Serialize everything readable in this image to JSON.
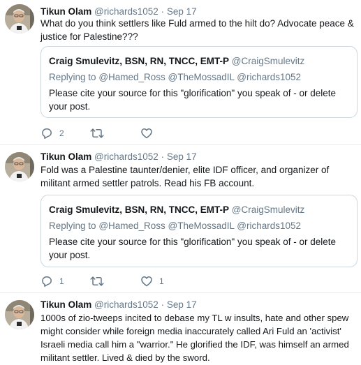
{
  "tweets": [
    {
      "name": "Tikun Olam",
      "handle": "@richards1052",
      "dot": "·",
      "date": "Sep 17",
      "text": "What do you think settlers like Fuld armed to the hilt do? Advocate peace & justice for Palestine???",
      "quote": {
        "name": "Craig Smulevitz, BSN, RN, TNCC, EMT-P",
        "handle": "@CraigSmulevitz",
        "replying_prefix": "Replying to",
        "mentions": "@Hamed_Ross @TheMossadIL @richards1052",
        "text": "Please cite your source for this \"glorification\" you speak of - or delete your post."
      },
      "reply_count": "2",
      "retweet_count": "",
      "like_count": ""
    },
    {
      "name": "Tikun Olam",
      "handle": "@richards1052",
      "dot": "·",
      "date": "Sep 17",
      "text": "Fold was a Palestine taunter/denier, elite IDF officer, and organizer of militant armed settler patrols. Read his FB account.",
      "quote": {
        "name": "Craig Smulevitz, BSN, RN, TNCC, EMT-P",
        "handle": "@CraigSmulevitz",
        "replying_prefix": "Replying to",
        "mentions": "@Hamed_Ross @TheMossadIL @richards1052",
        "text": "Please cite your source for this \"glorification\" you speak of - or delete your post."
      },
      "reply_count": "1",
      "retweet_count": "",
      "like_count": "1"
    },
    {
      "name": "Tikun Olam",
      "handle": "@richards1052",
      "dot": "·",
      "date": "Sep 17",
      "text": "1000s of zio-tweeps incited to debase my TL w insults, hate and other spew might consider  while foreign media inaccurately called Ari Fuld an 'activist' Israeli media call him a \"warrior.\" He glorified the IDF, was himself an armed militant settler. Lived & died by the sword."
    }
  ],
  "icons": {
    "reply": "reply-icon",
    "retweet": "retweet-icon",
    "like": "heart-icon",
    "avatar": "avatar"
  },
  "colors": {
    "text": "#14171a",
    "secondary": "#657786",
    "border": "#ccd6dd",
    "divider": "#e6ecf0"
  }
}
